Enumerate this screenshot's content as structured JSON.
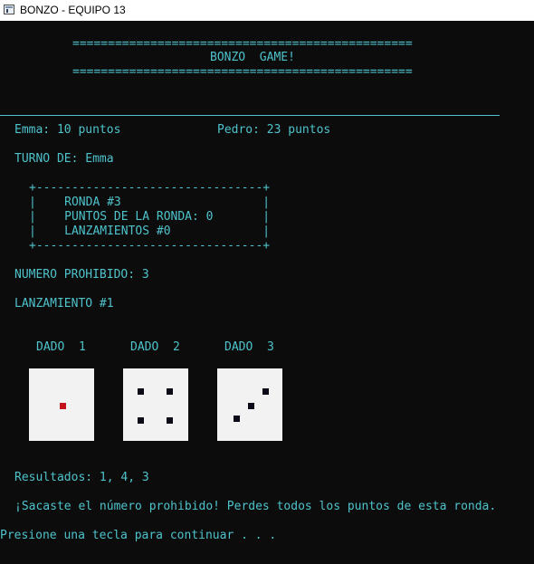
{
  "window": {
    "title": "BONZO - EQUIPO 13"
  },
  "banner": {
    "top_rule": "================================================",
    "title": "BONZO  GAME!",
    "bottom_rule": "================================================"
  },
  "scores": {
    "player1": "Emma: 10 puntos",
    "player2": "Pedro: 23 puntos"
  },
  "turn": "TURNO DE: Emma",
  "round_box": {
    "top_border": "+--------------------------------+",
    "round": "|    RONDA #3                    |",
    "round_points": "|    PUNTOS DE LA RONDA: 0       |",
    "throws": "|    LANZAMIENTOS #0             |",
    "bottom_border": "+--------------------------------+"
  },
  "forbidden_number": "NUMERO PROHIBIDO: 3",
  "throw_label": "LANZAMIENTO #1",
  "dice": [
    {
      "label": "DADO  1",
      "value": 1
    },
    {
      "label": "DADO  2",
      "value": 4
    },
    {
      "label": "DADO  3",
      "value": 3
    }
  ],
  "results": "Resultados: 1, 4, 3",
  "message": "¡Sacaste el número prohibido! Perdes todos los puntos de esta ronda.",
  "prompt": "Presione una tecla para continuar . . .",
  "colors": {
    "terminal_bg": "#0c0c0c",
    "terminal_text": "#4ec3cc",
    "die_face": "#f2f2f2",
    "pip_dark": "#0a0a18",
    "pip_red": "#c4101b"
  }
}
